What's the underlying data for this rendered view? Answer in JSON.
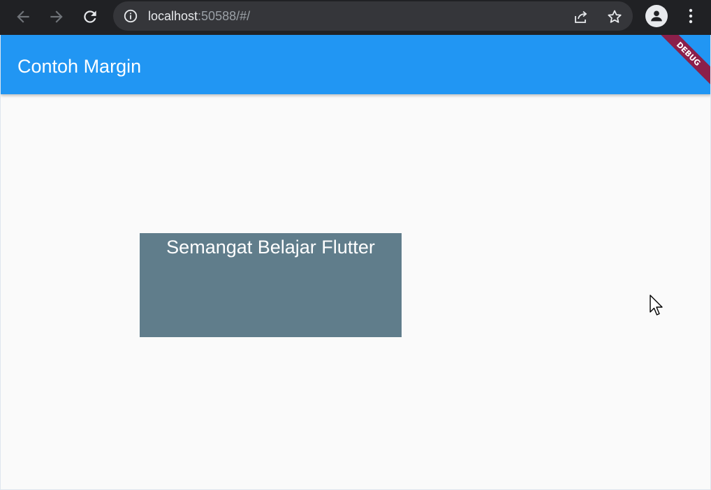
{
  "browser": {
    "url_host": "localhost",
    "url_rest": ":50588/#/",
    "icons": {
      "back": "back-arrow-icon",
      "forward": "forward-arrow-icon",
      "reload": "reload-icon",
      "info": "info-icon",
      "share": "share-icon",
      "bookmark": "bookmark-star-icon",
      "profile": "profile-icon",
      "menu": "kebab-menu-icon"
    },
    "colors": {
      "toolbar": "#202124",
      "address_bar": "#35363a"
    }
  },
  "app": {
    "title": "Contoh Margin",
    "debug_banner": "DEBUG",
    "box_text": "Semangat Belajar Flutter",
    "colors": {
      "app_bar": "#2196f3",
      "box": "#607d8b",
      "background": "#fafafa",
      "debug_banner": "#8b1f4a"
    }
  }
}
